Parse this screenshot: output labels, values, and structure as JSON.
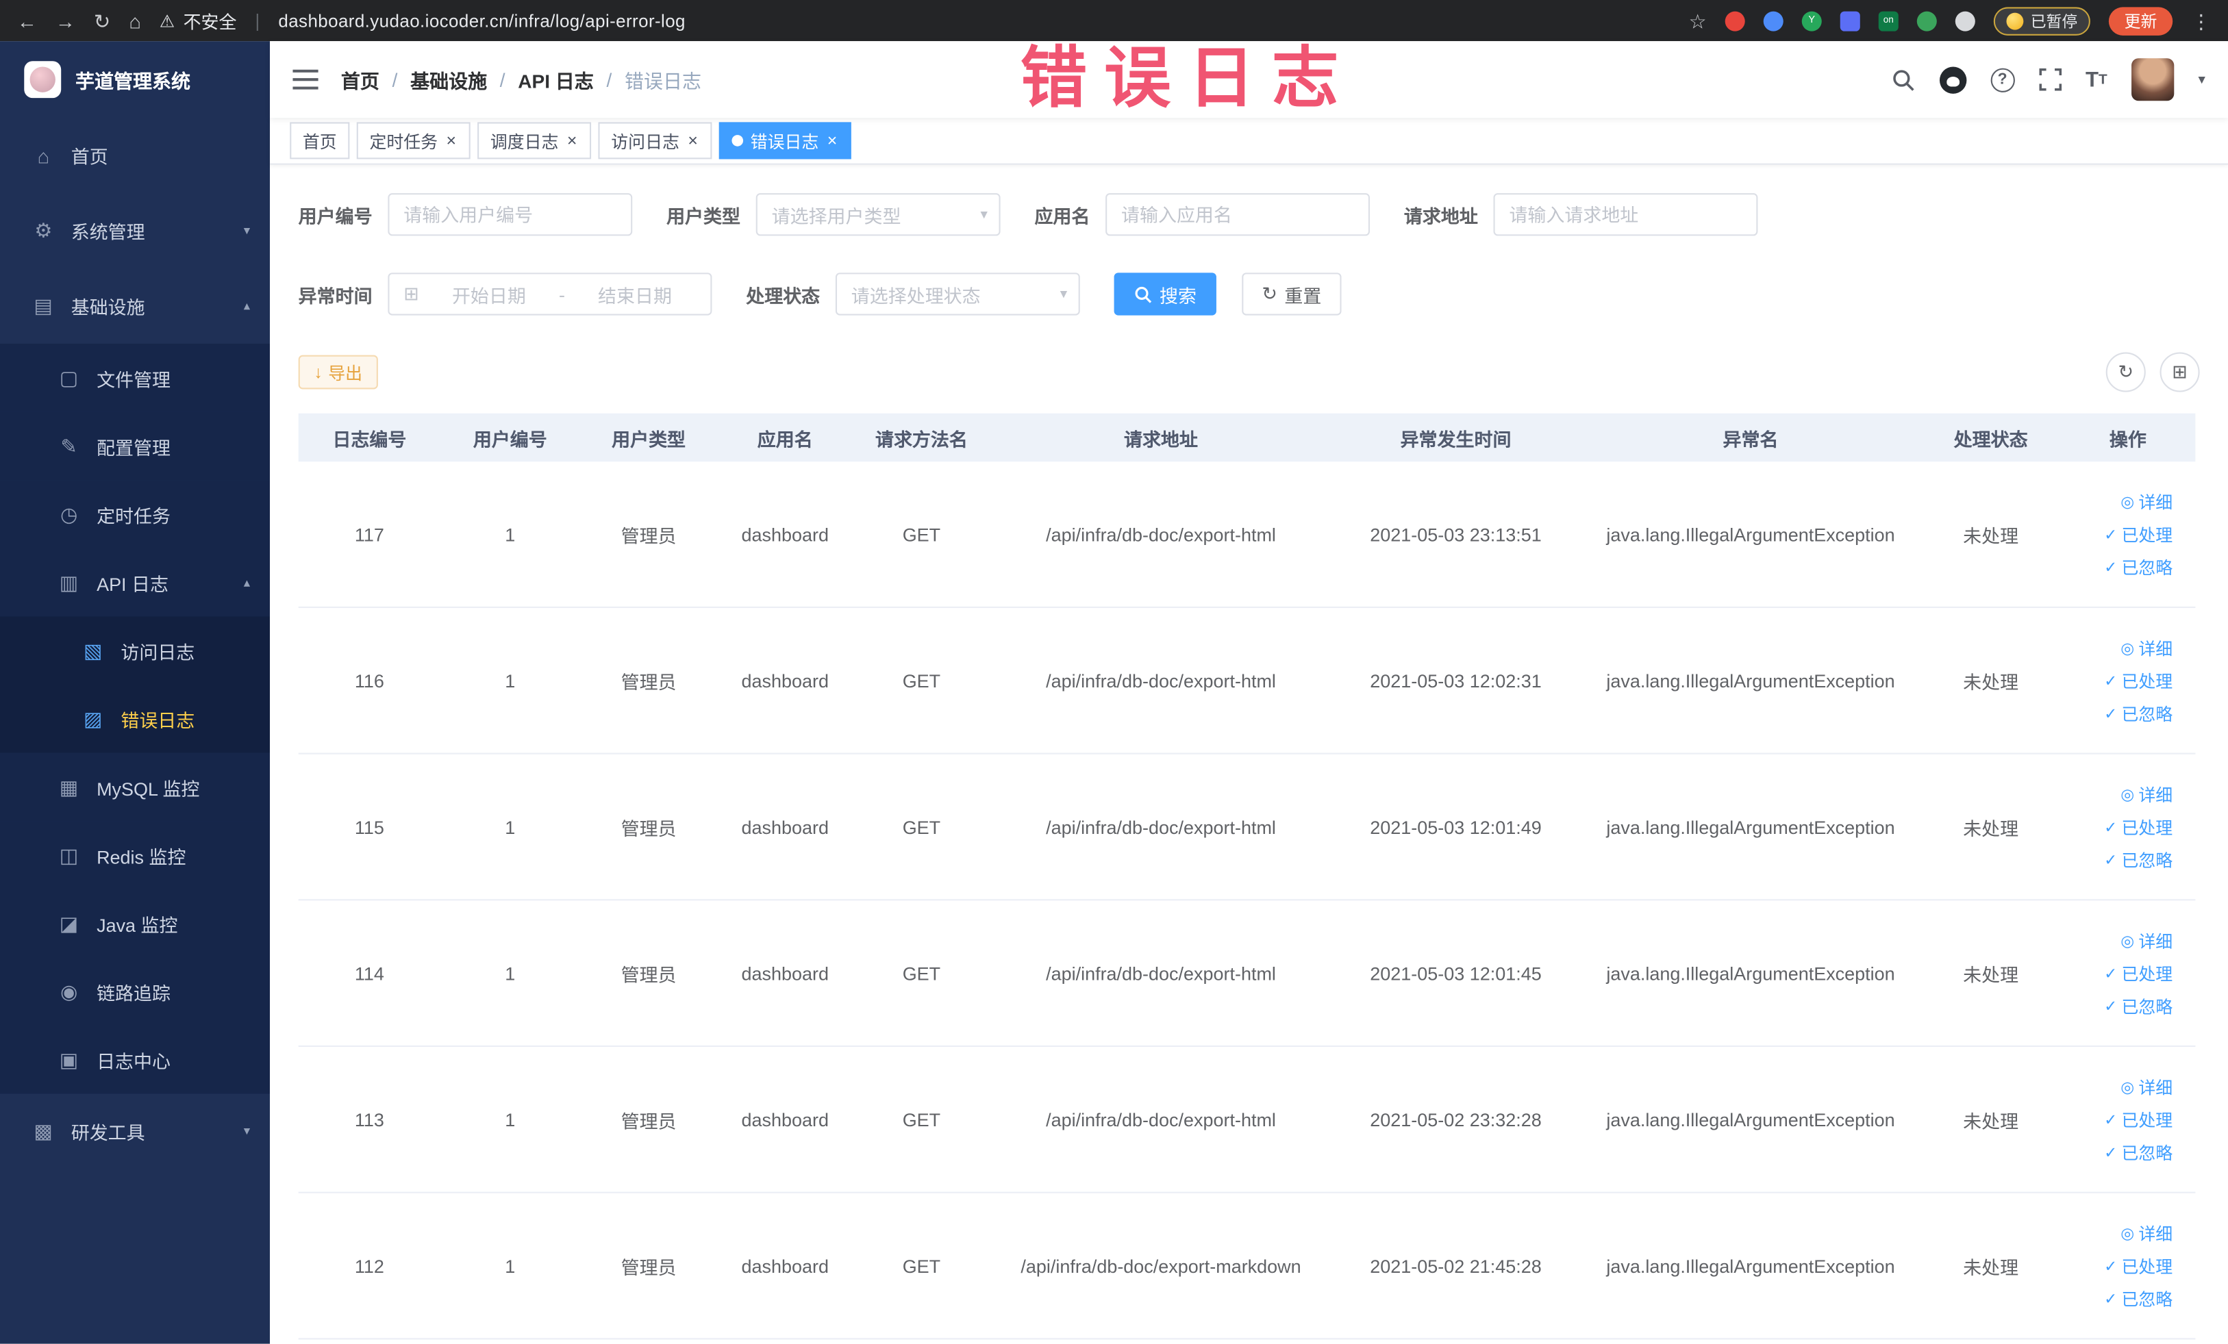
{
  "colors": {
    "accent": "#409eff",
    "warning": "#e6a23c",
    "annotation_red": "#ee3e5e",
    "sidebar_bg": "#1f3056",
    "active_menu_text": "#ffd04b"
  },
  "browser": {
    "security_warning": "不安全",
    "url": "dashboard.yudao.iocoder.cn/infra/log/api-error-log",
    "paused_badge": "已暂停",
    "update_button": "更新"
  },
  "annotation": {
    "watermark": "错误日志"
  },
  "sidebar": {
    "logo_title": "芋道管理系统",
    "items": [
      {
        "id": "home",
        "label": "首页",
        "icon": "home-icon",
        "glyph": "⌂",
        "level": 1
      },
      {
        "id": "system-management",
        "label": "系统管理",
        "icon": "gear-icon",
        "glyph": "⚙",
        "level": 1,
        "chevron": "down"
      },
      {
        "id": "infrastructure",
        "label": "基础设施",
        "icon": "infrastructure-icon",
        "glyph": "▤",
        "level": 1,
        "chevron": "up"
      },
      {
        "id": "file-management",
        "label": "文件管理",
        "icon": "file-icon",
        "glyph": "▢",
        "level": 2
      },
      {
        "id": "config-management",
        "label": "配置管理",
        "icon": "edit-icon",
        "glyph": "✎",
        "level": 2
      },
      {
        "id": "scheduled-tasks",
        "label": "定时任务",
        "icon": "timer-icon",
        "glyph": "◷",
        "level": 2
      },
      {
        "id": "api-log",
        "label": "API 日志",
        "icon": "api-log-icon",
        "glyph": "▥",
        "level": 2,
        "chevron": "up"
      },
      {
        "id": "access-log",
        "label": "访问日志",
        "icon": "access-log-icon",
        "glyph": "▧",
        "level": 3,
        "icon_blue": true
      },
      {
        "id": "error-log",
        "label": "错误日志",
        "icon": "error-log-icon",
        "glyph": "▨",
        "level": 3,
        "icon_blue": true,
        "active": true
      },
      {
        "id": "mysql-monitor",
        "label": "MySQL 监控",
        "icon": "mysql-icon",
        "glyph": "▦",
        "level": 2
      },
      {
        "id": "redis-monitor",
        "label": "Redis 监控",
        "icon": "redis-icon",
        "glyph": "◫",
        "level": 2
      },
      {
        "id": "java-monitor",
        "label": "Java 监控",
        "icon": "java-icon",
        "glyph": "◪",
        "level": 2
      },
      {
        "id": "trace",
        "label": "链路追踪",
        "icon": "trace-icon",
        "glyph": "◉",
        "level": 2
      },
      {
        "id": "log-center",
        "label": "日志中心",
        "icon": "log-center-icon",
        "glyph": "▣",
        "level": 2
      },
      {
        "id": "dev-tools",
        "label": "研发工具",
        "icon": "devtools-icon",
        "glyph": "▩",
        "level": 1,
        "chevron": "down"
      }
    ]
  },
  "navbar": {
    "breadcrumb": [
      {
        "label": "首页"
      },
      {
        "label": "基础设施"
      },
      {
        "label": "API 日志"
      },
      {
        "label": "错误日志",
        "current": true
      }
    ]
  },
  "tabs": [
    {
      "id": "home",
      "label": "首页"
    },
    {
      "id": "scheduled-tasks",
      "label": "定时任务",
      "closable": true
    },
    {
      "id": "job-log",
      "label": "调度日志",
      "closable": true
    },
    {
      "id": "access-log",
      "label": "访问日志",
      "closable": true
    },
    {
      "id": "error-log",
      "label": "错误日志",
      "closable": true,
      "active": true
    }
  ],
  "filters": {
    "user_id": {
      "label": "用户编号",
      "placeholder": "请输入用户编号"
    },
    "user_type": {
      "label": "用户类型",
      "placeholder": "请选择用户类型"
    },
    "app_name": {
      "label": "应用名",
      "placeholder": "请输入应用名"
    },
    "request_url": {
      "label": "请求地址",
      "placeholder": "请输入请求地址"
    },
    "exception_time": {
      "label": "异常时间",
      "start_placeholder": "开始日期",
      "separator": "-",
      "end_placeholder": "结束日期"
    },
    "process_status": {
      "label": "处理状态",
      "placeholder": "请选择处理状态"
    },
    "search_button": "搜索",
    "reset_button": "重置"
  },
  "toolbar": {
    "export_label": "导出"
  },
  "table": {
    "columns": [
      "日志编号",
      "用户编号",
      "用户类型",
      "应用名",
      "请求方法名",
      "请求地址",
      "异常发生时间",
      "异常名",
      "处理状态",
      "操作"
    ],
    "row_actions": [
      {
        "id": "detail",
        "label": "详细",
        "icon": "view-icon",
        "glyph": "◎"
      },
      {
        "id": "processed",
        "label": "已处理",
        "icon": "check-icon",
        "glyph": "✓"
      },
      {
        "id": "ignored",
        "label": "已忽略",
        "icon": "check-icon",
        "glyph": "✓"
      }
    ],
    "rows": [
      {
        "id": "117",
        "user_id": "1",
        "user_type": "管理员",
        "app": "dashboard",
        "method": "GET",
        "url": "/api/infra/db-doc/export-html",
        "time": "2021-05-03 23:13:51",
        "exception": "java.lang.IllegalArgumentException",
        "status": "未处理"
      },
      {
        "id": "116",
        "user_id": "1",
        "user_type": "管理员",
        "app": "dashboard",
        "method": "GET",
        "url": "/api/infra/db-doc/export-html",
        "time": "2021-05-03 12:02:31",
        "exception": "java.lang.IllegalArgumentException",
        "status": "未处理"
      },
      {
        "id": "115",
        "user_id": "1",
        "user_type": "管理员",
        "app": "dashboard",
        "method": "GET",
        "url": "/api/infra/db-doc/export-html",
        "time": "2021-05-03 12:01:49",
        "exception": "java.lang.IllegalArgumentException",
        "status": "未处理"
      },
      {
        "id": "114",
        "user_id": "1",
        "user_type": "管理员",
        "app": "dashboard",
        "method": "GET",
        "url": "/api/infra/db-doc/export-html",
        "time": "2021-05-03 12:01:45",
        "exception": "java.lang.IllegalArgumentException",
        "status": "未处理"
      },
      {
        "id": "113",
        "user_id": "1",
        "user_type": "管理员",
        "app": "dashboard",
        "method": "GET",
        "url": "/api/infra/db-doc/export-html",
        "time": "2021-05-02 23:32:28",
        "exception": "java.lang.IllegalArgumentException",
        "status": "未处理"
      },
      {
        "id": "112",
        "user_id": "1",
        "user_type": "管理员",
        "app": "dashboard",
        "method": "GET",
        "url": "/api/infra/db-doc/export-markdown",
        "time": "2021-05-02 21:45:28",
        "exception": "java.lang.IllegalArgumentException",
        "status": "未处理"
      }
    ]
  }
}
